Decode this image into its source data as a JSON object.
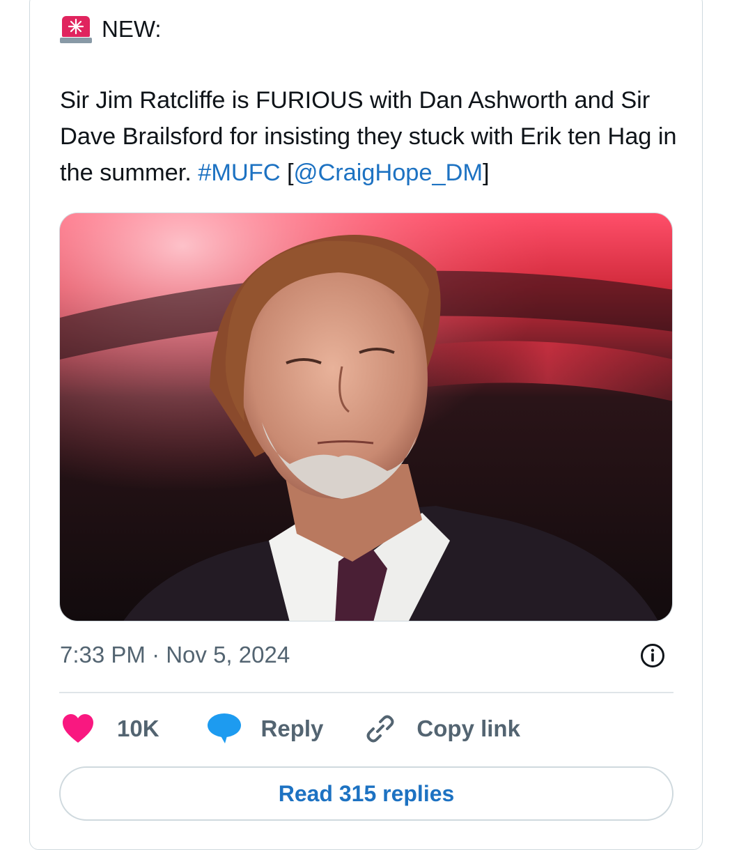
{
  "tweet": {
    "alert_label": "NEW:",
    "text_plain": "Sir Jim Ratcliffe is FURIOUS with Dan Ashworth and Sir Dave Brailsford for insisting they stuck with Erik ten Hag in the summer. ",
    "hashtag": "#MUFC",
    "bracket_open": " [",
    "mention": "@CraigHope_DM",
    "bracket_close": "]",
    "timestamp": "7:33 PM · Nov 5, 2024"
  },
  "actions": {
    "likes": "10K",
    "reply_label": "Reply",
    "copy_link_label": "Copy link"
  },
  "read_replies_label": "Read 315 replies",
  "icons": {
    "alert": "police-siren-icon",
    "info": "info-icon",
    "like": "heart-icon",
    "reply": "speech-bubble-icon",
    "copy_link": "link-icon"
  },
  "colors": {
    "link": "#1d72c2",
    "like": "#f91880",
    "reply": "#1d9bf0",
    "muted": "#536471"
  }
}
